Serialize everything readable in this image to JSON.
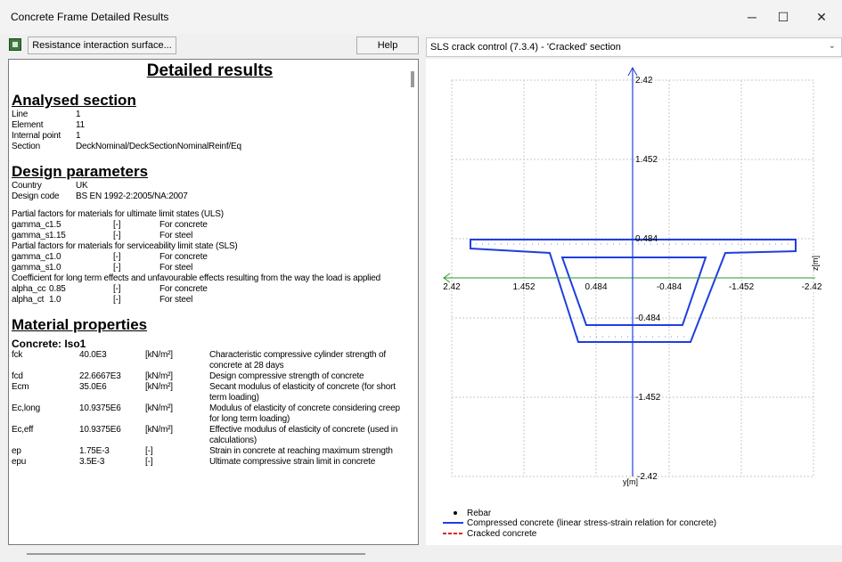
{
  "window": {
    "title": "Concrete Frame Detailed Results",
    "minimize_glyph": "─",
    "maximize_glyph": "☐",
    "close_glyph": "✕"
  },
  "toolbar": {
    "icon": "calculator-icon",
    "interaction_button": "Resistance interaction surface...",
    "help_button": "Help"
  },
  "report": {
    "title": "Detailed results",
    "analysed": {
      "heading": "Analysed section",
      "rows": [
        [
          "Line",
          "1"
        ],
        [
          "Element",
          "11"
        ],
        [
          "Internal point",
          "1"
        ],
        [
          "Section",
          "DeckNominal/DeckSectionNominalReinf/EquivalentDeck/Reinforced Concrete"
        ]
      ]
    },
    "design": {
      "heading": "Design parameters",
      "rows": [
        [
          "Country",
          "UK"
        ],
        [
          "Design code",
          "BS EN 1992-2:2005/NA:2007"
        ]
      ],
      "uls_title": "Partial factors for materials for ultimate limit states (ULS)",
      "uls_rows": [
        [
          "gamma_c",
          "1.5",
          "[-]",
          "For concrete"
        ],
        [
          "gamma_s",
          "1.15",
          "[-]",
          "For steel"
        ]
      ],
      "sls_title": "Partial factors for materials for serviceability limit state (SLS)",
      "sls_rows": [
        [
          "gamma_c",
          "1.0",
          "[-]",
          "For concrete"
        ],
        [
          "gamma_s",
          "1.0",
          "[-]",
          "For steel"
        ]
      ],
      "coef_title": "Coefficient for long term effects and unfavourable effects resulting from the way the load is applied",
      "coef_rows": [
        [
          "alpha_cc",
          "0.85",
          "[-]",
          "For concrete"
        ],
        [
          "alpha_ct",
          "1.0",
          "[-]",
          "For steel"
        ]
      ]
    },
    "material": {
      "heading": "Material properties",
      "concrete_title": "Concrete: Iso1",
      "rows": [
        [
          "fck",
          "40.0E3",
          "[kN/m²]",
          "Characteristic compressive cylinder strength of concrete at 28 days"
        ],
        [
          "fcd",
          "22.6667E3",
          "[kN/m²]",
          "Design compressive strength of concrete"
        ],
        [
          "Ecm",
          "35.0E6",
          "[kN/m²]",
          "Secant modulus of elasticity of concrete (for short term loading)"
        ],
        [
          "Ec,long",
          "10.9375E6",
          "[kN/m²]",
          "Modulus of elasticity of concrete considering creep for long term loading)"
        ],
        [
          "Ec,eff",
          "10.9375E6",
          "[kN/m²]",
          "Effective modulus of elasticity of concrete (used in calculations)"
        ],
        [
          "ep",
          "1.75E-3",
          "[-]",
          "Strain in concrete at reaching maximum strength"
        ],
        [
          "epu",
          "3.5E-3",
          "[-]",
          "Ultimate compressive strain limit in concrete"
        ]
      ]
    }
  },
  "plot": {
    "selector_value": "SLS crack control (7.3.4) - 'Cracked' section",
    "x_ticks": [
      "2.42",
      "1.452",
      "0.484",
      "-0.484",
      "-1.452",
      "-2.42"
    ],
    "y_ticks": [
      "2.42",
      "1.452",
      "0.484",
      "-0.484",
      "-1.452",
      "-2.42"
    ],
    "z_axis_label": "z[m]",
    "y_axis_label": "y[m]",
    "legend": [
      {
        "label": "Rebar",
        "marker": "dot"
      },
      {
        "label": "Compressed concrete (linear stress-strain relation for concrete)",
        "marker": "solid-line",
        "color": "#1f3fe0"
      },
      {
        "label": "Cracked concrete",
        "marker": "dashed-line",
        "color": "#e02020"
      }
    ],
    "axis_color": "#1f3fe0",
    "horizontal_axis_color": "#2a9a2a",
    "section_color": "#1f3fe0"
  }
}
